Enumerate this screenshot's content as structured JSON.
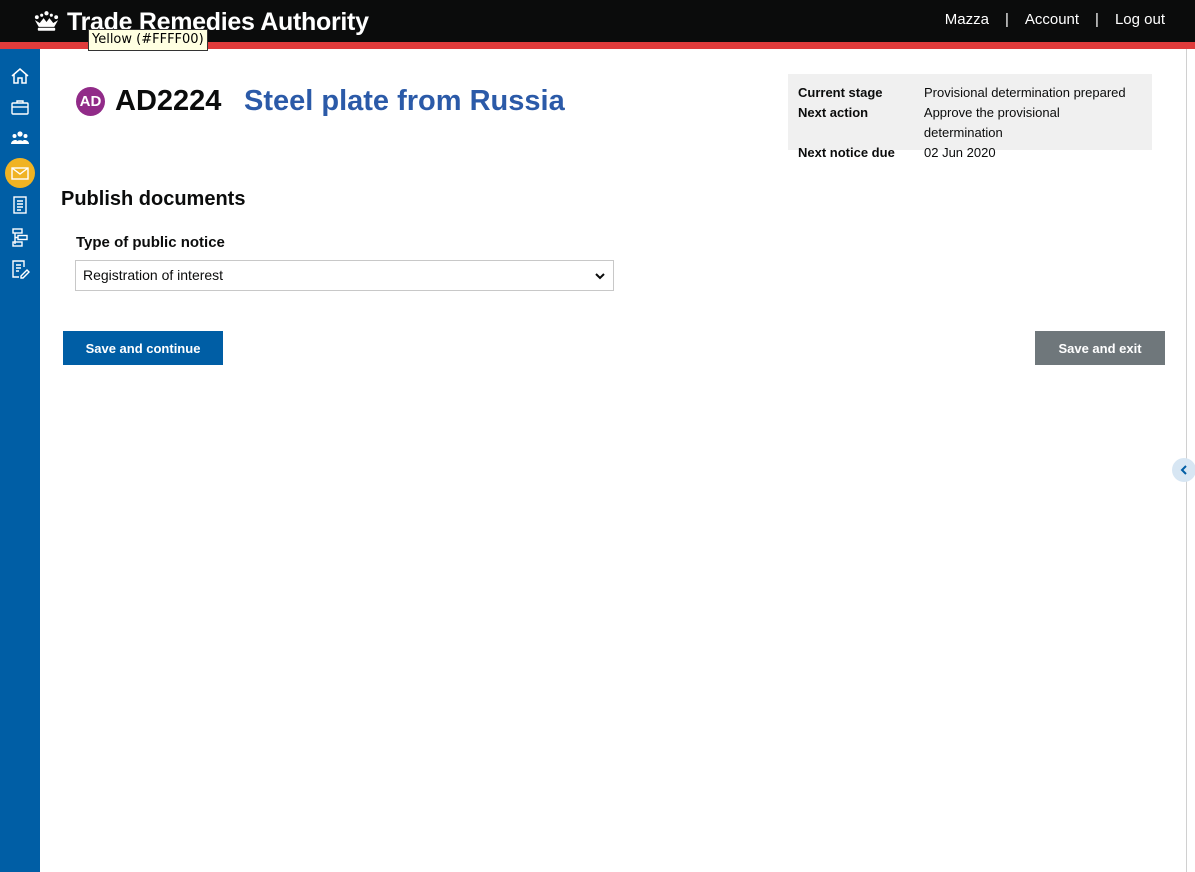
{
  "header": {
    "brand": "Trade Remedies Authority",
    "nav": {
      "user": "Mazza",
      "separator": "|",
      "account": "Account",
      "logout": "Log out"
    }
  },
  "tooltip": "Yellow (#FFFF00)",
  "sidebar": {
    "items": [
      {
        "name": "home-icon"
      },
      {
        "name": "briefcase-icon"
      },
      {
        "name": "people-icon"
      },
      {
        "name": "envelope-icon",
        "active": true
      },
      {
        "name": "document-list-icon"
      },
      {
        "name": "sitemap-icon"
      },
      {
        "name": "document-edit-icon"
      }
    ]
  },
  "case": {
    "badge": "AD",
    "number": "AD2224",
    "name": "Steel plate from Russia",
    "info": [
      {
        "key": "Current stage",
        "value": "Provisional determination prepared"
      },
      {
        "key": "Next action",
        "value": "Approve the provisional determination"
      },
      {
        "key": "Next notice due",
        "value": "02 Jun 2020"
      }
    ]
  },
  "form": {
    "title": "Publish documents",
    "notice_label": "Type of public notice",
    "notice_selected": "Registration of interest"
  },
  "buttons": {
    "save_continue": "Save and continue",
    "save_exit": "Save and exit"
  },
  "colors": {
    "header": "#0b0c0c",
    "header_stripe": "#e03b3b",
    "sidebar": "#005ea5",
    "sidebar_active": "#f0b323",
    "badge": "#912b88",
    "case_name": "#2b5aa8",
    "primary_button": "#005ea5",
    "secondary_button": "#6f777b"
  }
}
